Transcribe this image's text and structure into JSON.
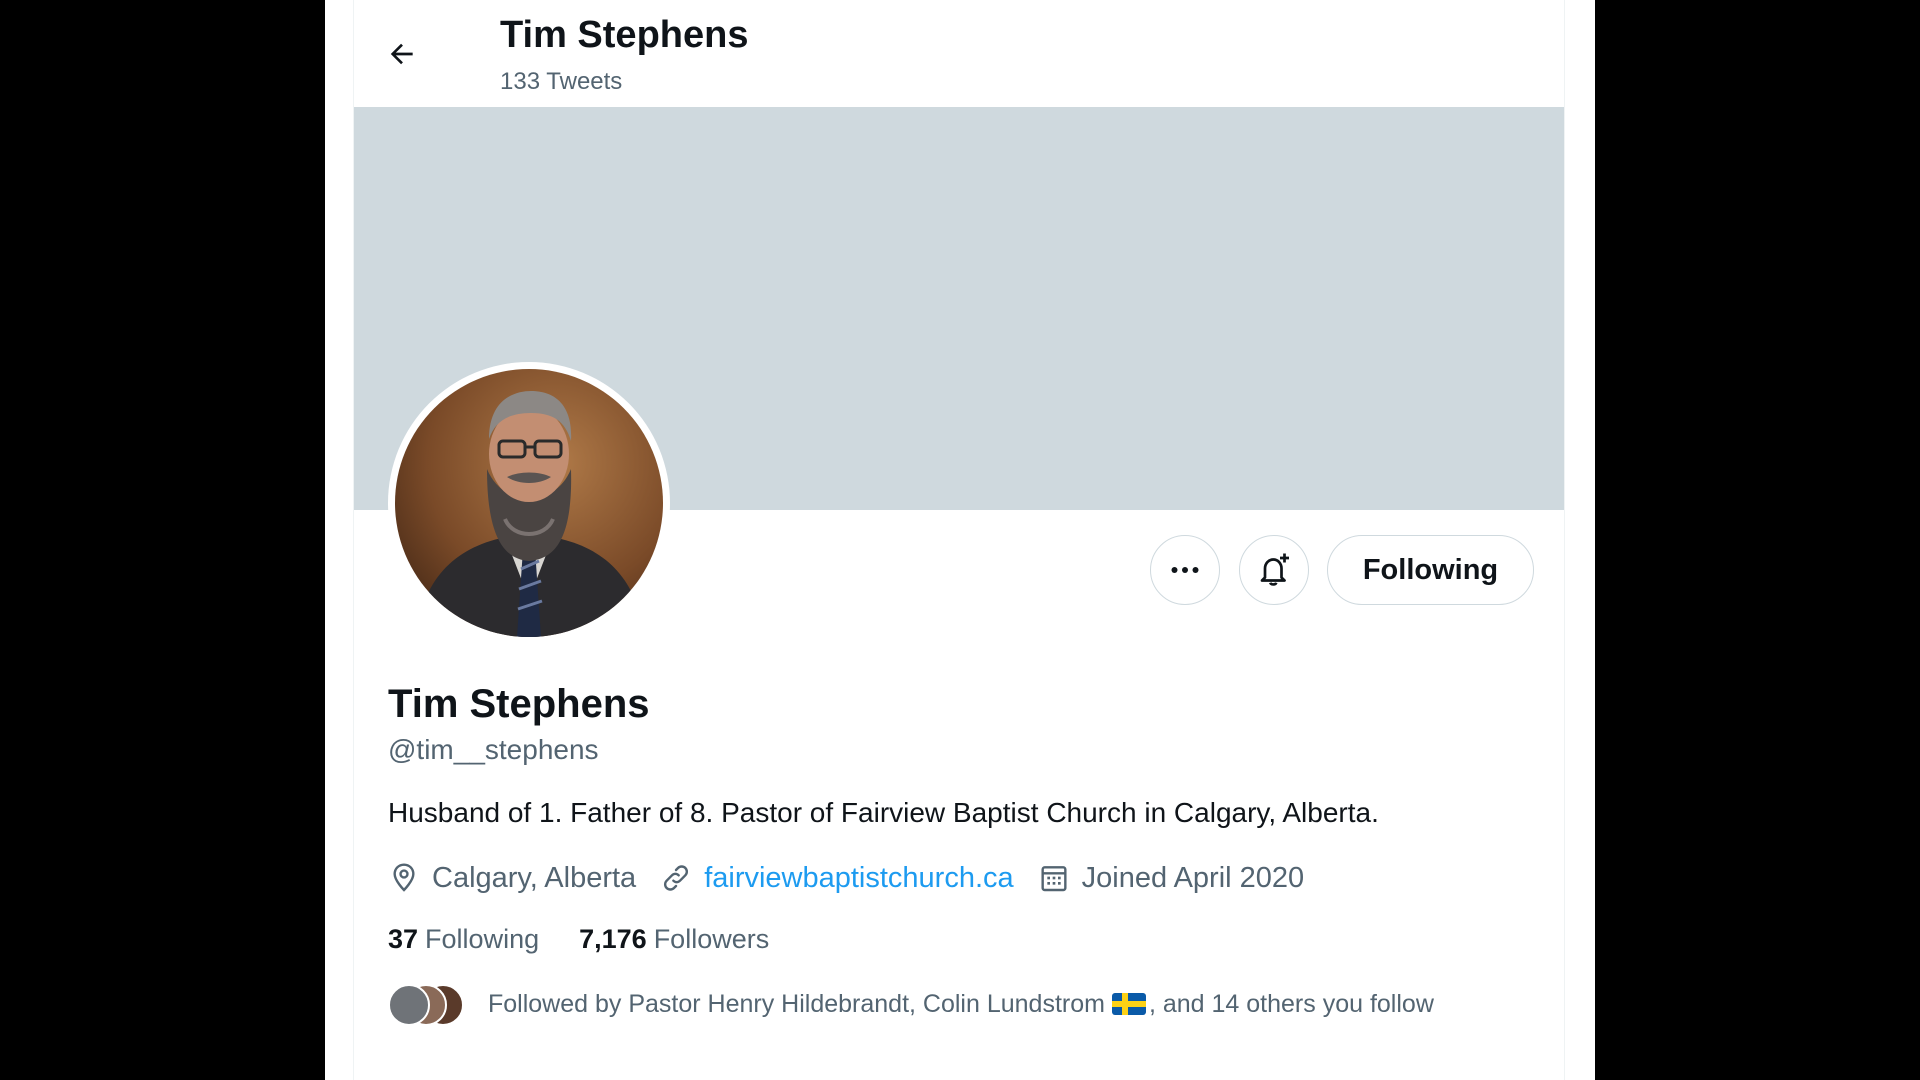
{
  "header": {
    "name": "Tim Stephens",
    "tweet_count": "133 Tweets"
  },
  "profile": {
    "display_name": "Tim Stephens",
    "handle": "@tim__stephens",
    "bio": "Husband of 1. Father of 8. Pastor of Fairview Baptist Church in Calgary, Alberta.",
    "location": "Calgary, Alberta",
    "website": "fairviewbaptistchurch.ca",
    "joined": "Joined April 2020"
  },
  "actions": {
    "following_label": "Following"
  },
  "stats": {
    "following_count": "37",
    "following_label": "Following",
    "followers_count": "7,176",
    "followers_label": "Followers"
  },
  "followed_by": {
    "prefix": "Followed by Pastor Henry Hildebrandt, Colin Lundstrom",
    "flag": "🇸🇪",
    "suffix": ", and 14 others you follow"
  },
  "colors": {
    "background": "#000000",
    "banner": "#cfd9de",
    "link": "#1d9bf0",
    "primary_text": "#0f1419",
    "secondary_text": "#536471"
  },
  "icons": [
    "back-arrow-icon",
    "more-icon",
    "bell-plus-icon",
    "location-pin-icon",
    "link-icon",
    "calendar-icon"
  ]
}
